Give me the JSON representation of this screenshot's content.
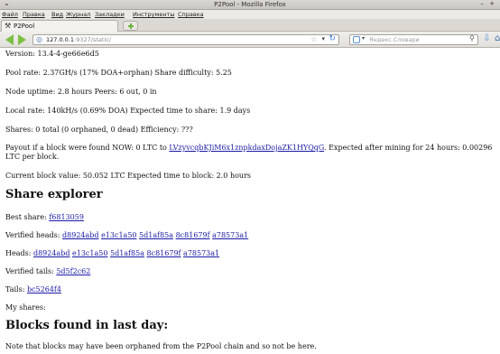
{
  "window": {
    "title": "P2Pool - Mozilla Firefox",
    "wm_left": "⌄",
    "wm_right": "– +"
  },
  "menu": [
    "Файл",
    "Правка",
    "Вид",
    "Журнал",
    "Закладки",
    "Инструменты",
    "Справка"
  ],
  "tab": {
    "label": "P2Pool",
    "favicon": "hammer-icon"
  },
  "navbar": {
    "url_host": "127.0.0.1",
    "url_rest": ":9327/static/",
    "search_placeholder": "Яндекс.Словари"
  },
  "page": {
    "version": "Version: 13.4-4-ge66e6d5",
    "pool_rate": "Pool rate: 2.37GH/s (17% DOA+orphan) Share difficulty: 5.25",
    "node_uptime": "Node uptime: 2.8 hours Peers: 6 out, 0 in",
    "local_rate": "Local rate: 140kH/s (0.69% DOA) Expected time to share: 1.9 days",
    "shares": "Shares: 0 total (0 orphaned, 0 dead) Efficiency: ???",
    "payout_prefix": "Payout if a block were found NOW: 0 LTC to ",
    "payout_address": "LVzyvcqbKJiM6x1znpkdaxDojaZK1HYQqG",
    "payout_suffix": ". Expected after mining for 24 hours: 0.00296 LTC per block.",
    "block_value": "Current block value: 50.052 LTC Expected time to block: 2.0 hours",
    "share_explorer_title": "Share explorer",
    "best_share_label": "Best share: ",
    "best_share": "f6813059",
    "verified_heads_label": "Verified heads: ",
    "verified_heads": [
      "d8924abd",
      "e13c1a50",
      "5d1af85a",
      "8c81679f",
      "a78573a1"
    ],
    "heads_label": "Heads: ",
    "heads": [
      "d8924abd",
      "e13c1a50",
      "5d1af85a",
      "8c81679f",
      "a78573a1"
    ],
    "verified_tails_label": "Verified tails: ",
    "verified_tails": [
      "5d5f2c62"
    ],
    "tails_label": "Tails: ",
    "tails": [
      "bc5264f4"
    ],
    "my_shares": "My shares:",
    "blocks_title": "Blocks found in last day:",
    "blocks_note": "Note that blocks may have been orphaned from the P2Pool chain and so not be here."
  }
}
